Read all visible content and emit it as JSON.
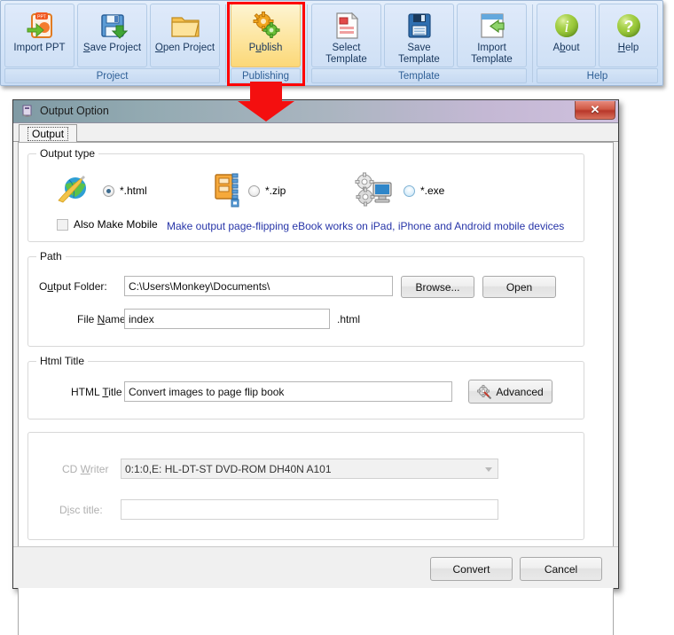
{
  "ribbon": {
    "groups": [
      {
        "caption": "Project",
        "buttons": [
          {
            "label_pre": "",
            "label_u": "",
            "label_post": "Import PPT",
            "icon": "import-ppt-icon"
          },
          {
            "label_pre": "",
            "label_u": "S",
            "label_post": "ave Project",
            "icon": "save-project-icon"
          },
          {
            "label_pre": "",
            "label_u": "O",
            "label_post": "pen Project",
            "icon": "open-project-icon"
          }
        ]
      },
      {
        "caption": "Publishing",
        "buttons": [
          {
            "label_pre": "P",
            "label_u": "u",
            "label_post": "blish",
            "icon": "publish-gears-icon"
          }
        ]
      },
      {
        "caption": "Template",
        "buttons": [
          {
            "label_pre": "",
            "label_u": "",
            "label_post": "Select Template",
            "icon": "select-template-icon"
          },
          {
            "label_pre": "",
            "label_u": "",
            "label_post": "Save Template",
            "icon": "save-template-icon"
          },
          {
            "label_pre": "",
            "label_u": "",
            "label_post": "Import Template",
            "icon": "import-template-icon"
          }
        ]
      },
      {
        "caption": "Help",
        "buttons": [
          {
            "label_pre": "A",
            "label_u": "b",
            "label_post": "out",
            "icon": "about-info-icon"
          },
          {
            "label_pre": "",
            "label_u": "H",
            "label_post": "elp",
            "icon": "help-question-icon"
          }
        ]
      }
    ],
    "highlight_color": "#ff0000"
  },
  "dialog": {
    "title": "Output Option",
    "close_label": "✕",
    "tab": {
      "label": "Output"
    },
    "output_type": {
      "caption": "Output type",
      "options": [
        {
          "label": "*.html",
          "selected": true,
          "icon": "globe-html-icon"
        },
        {
          "label": "*.zip",
          "selected": false,
          "icon": "zip-archive-icon"
        },
        {
          "label": "*.exe",
          "selected": false,
          "icon": "exe-gears-monitor-icon"
        }
      ],
      "mobile_checkbox_label": "Also Make Mobile",
      "mobile_checked": false,
      "mobile_note": "Make output page-flipping eBook works on iPad, iPhone and Android mobile devices",
      "mobile_note_color": "#2735a8"
    },
    "path": {
      "caption": "Path",
      "output_folder_label_pre": "O",
      "output_folder_label_u": "u",
      "output_folder_label_post": "tput Folder:",
      "output_folder_value": "C:\\Users\\Monkey\\Documents\\",
      "browse_label": "Browse...",
      "open_label": "Open",
      "file_name_label_pre": "File ",
      "file_name_label_u": "N",
      "file_name_label_post": "ame:",
      "file_name_value": "index",
      "file_ext": ".html"
    },
    "html_title": {
      "caption": "Html Title",
      "field_label_pre": "HTML ",
      "field_label_u": "T",
      "field_label_post": "itle",
      "value": "Convert images to page flip book",
      "advanced_label": "Advanced",
      "advanced_icon": "advanced-settings-icon"
    },
    "cd": {
      "writer_label_pre": "CD ",
      "writer_label_u": "W",
      "writer_label_post": "riter",
      "writer_value": "0:1:0,E: HL-DT-ST DVD-ROM DH40N   A101",
      "disc_title_label_pre": "D",
      "disc_title_label_u": "i",
      "disc_title_label_post": "sc title:",
      "disc_title_value": "",
      "disabled": true
    },
    "footer": {
      "convert_label": "Convert",
      "cancel_label": "Cancel"
    }
  }
}
